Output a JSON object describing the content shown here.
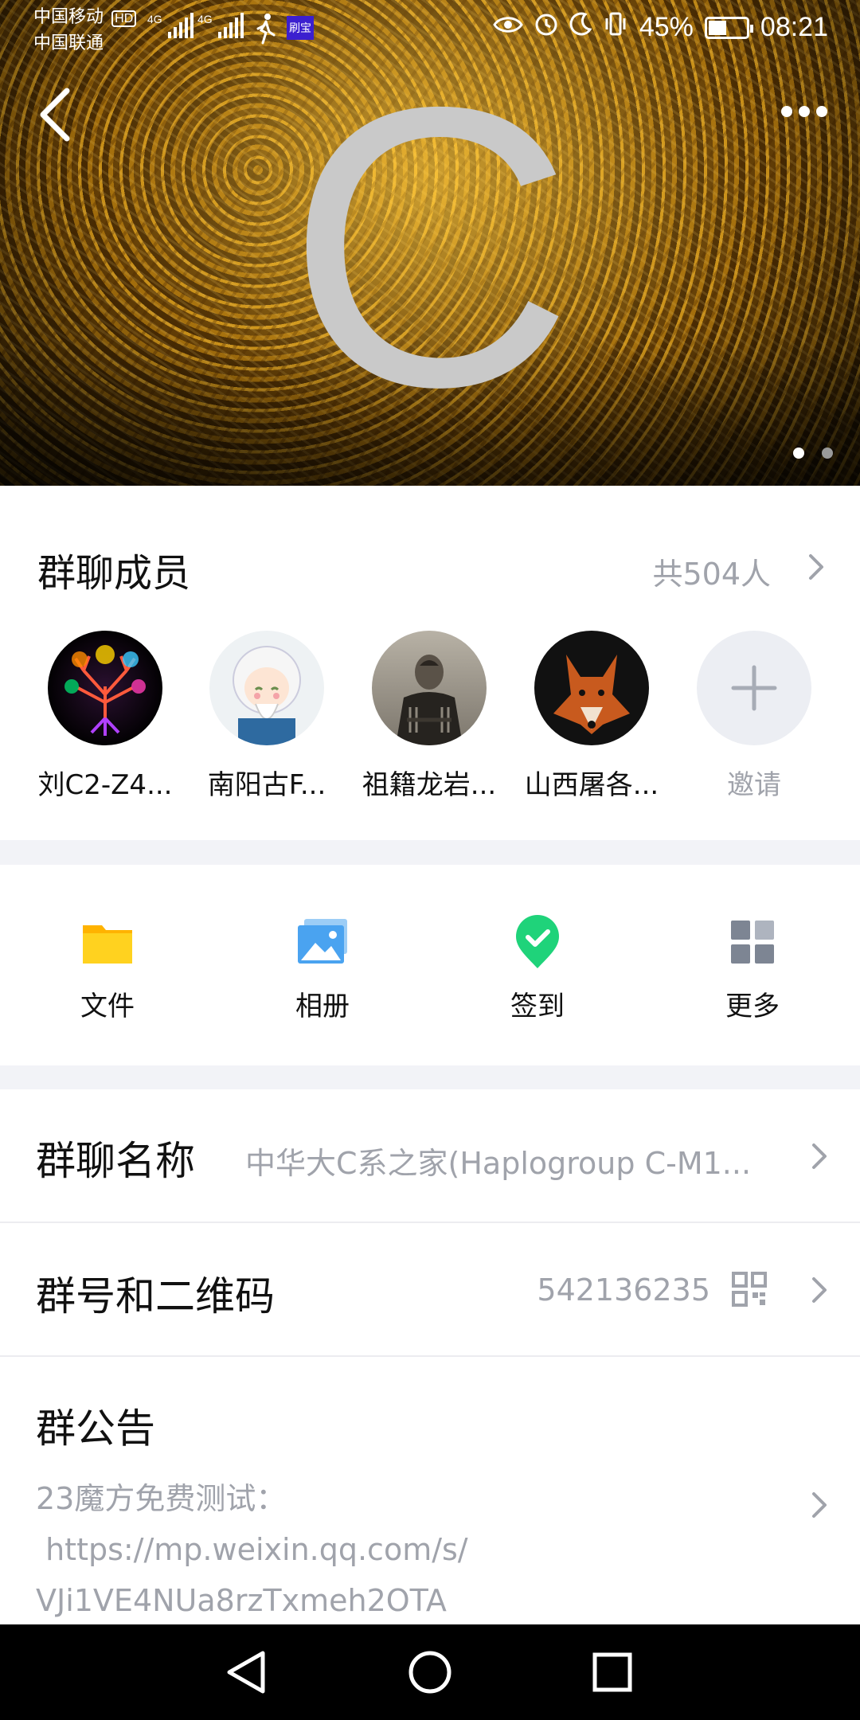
{
  "status": {
    "carrier1": "中国移动",
    "carrier1_badge": "HD",
    "carrier2": "中国联通",
    "network1": "4G",
    "network2": "4G",
    "app_badge": "刷宝",
    "battery": "45%",
    "time": "08:21"
  },
  "banner": {
    "letter": "C",
    "page_count": 2,
    "current_page": 1
  },
  "members": {
    "title": "群聊成员",
    "count": "共504人",
    "list": [
      {
        "name": "刘C2-Z4..."
      },
      {
        "name": "南阳古F..."
      },
      {
        "name": "祖籍龙岩..."
      },
      {
        "name": "山西屠各..."
      }
    ],
    "invite_label": "邀请"
  },
  "tools": [
    {
      "label": "文件",
      "icon": "folder-icon"
    },
    {
      "label": "相册",
      "icon": "album-icon"
    },
    {
      "label": "签到",
      "icon": "checkin-icon"
    },
    {
      "label": "更多",
      "icon": "grid-icon"
    }
  ],
  "group_name": {
    "label": "群聊名称",
    "value": "中华大C系之家(Haplogroup C-M1..."
  },
  "group_id": {
    "label": "群号和二维码",
    "value": "542136235"
  },
  "notice": {
    "label": "群公告",
    "line1": "23魔方免费测试：",
    "line2": " https://mp.weixin.qq.com/s/",
    "line3": "VJi1VE4NUa8rzTxmeh2OTA"
  },
  "colors": {
    "accent_green": "#1fd37a",
    "folder_yellow": "#ffc400",
    "album_blue": "#4aa3f0",
    "grid_gray": "#7d8593",
    "secondary_text": "#a0a3ab"
  }
}
